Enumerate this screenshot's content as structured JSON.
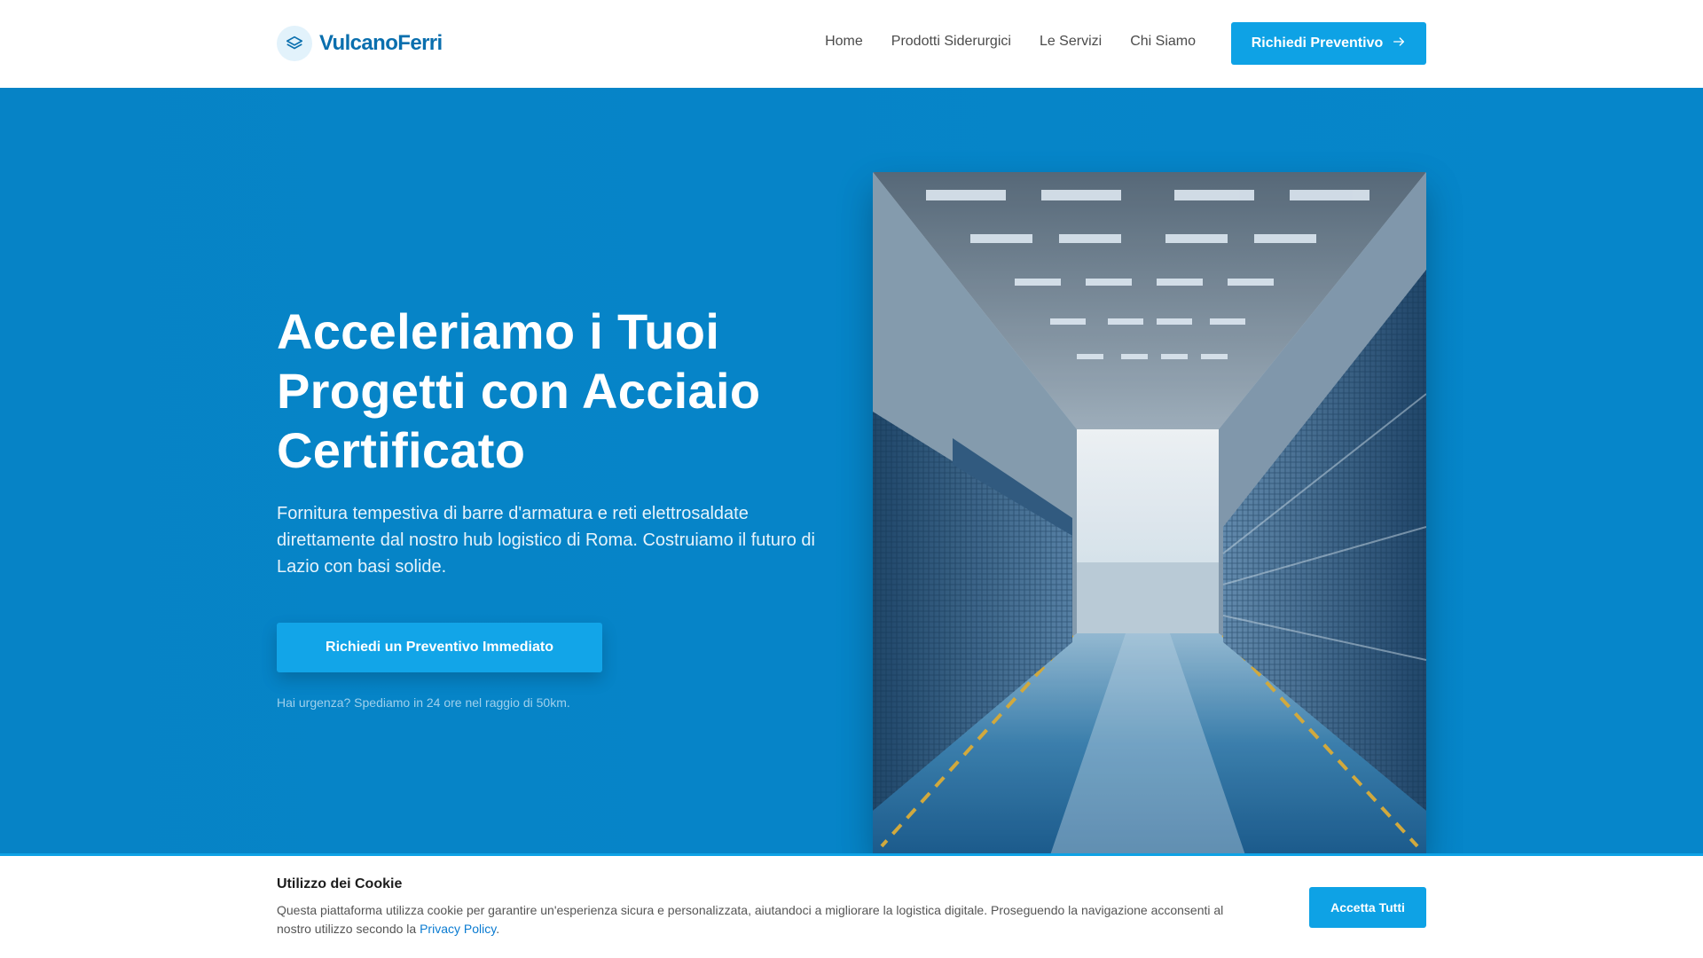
{
  "brand": {
    "name": "VulcanoFerri",
    "icon": "layers-icon"
  },
  "nav": {
    "items": [
      {
        "label": "Home"
      },
      {
        "label": "Prodotti Siderurgici"
      },
      {
        "label": "Le Servizi"
      },
      {
        "label": "Chi Siamo"
      }
    ],
    "cta_label": "Richiedi Preventivo",
    "cta_icon": "arrow-right-icon"
  },
  "hero": {
    "title": "Acceleriamo i Tuoi Progetti con Acciaio Certificato",
    "subtitle": "Fornitura tempestiva di barre d'armatura e reti elettrosaldate direttamente dal nostro hub logistico di Roma. Costruiamo il futuro di Lazio con basi solide.",
    "cta_label": "Richiedi un Preventivo Immediato",
    "note": "Hai urgenza? Spediamo in 24 ore nel raggio di 50km."
  },
  "cookie": {
    "title": "Utilizzo dei Cookie",
    "text": "Questa piattaforma utilizza cookie per garantire un'esperienza sicura e personalizzata, aiutandoci a migliorare la logistica digitale. Proseguendo la navigazione acconsenti al nostro utilizzo secondo la",
    "link_label": "Privacy Policy",
    "text_end": ".",
    "accept_label": "Accetta Tutti"
  },
  "colors": {
    "primary": "#0684c8",
    "accent": "#0ea2e5",
    "brand_text": "#0a6fae"
  }
}
